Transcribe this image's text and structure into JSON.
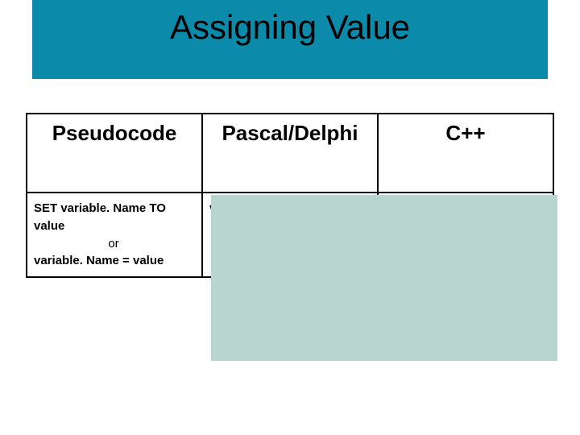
{
  "slide": {
    "title": "Assigning Value"
  },
  "table": {
    "headers": {
      "h1": "Pseudocode",
      "h2": "Pascal/Delphi",
      "h3": "C++"
    },
    "body": {
      "c1": {
        "line1": "SET variable. Name TO value",
        "line2": "or",
        "line3": "variable. Name = value"
      },
      "c2": {
        "line1": "v"
      },
      "c3": {
        "line1": ""
      }
    }
  }
}
